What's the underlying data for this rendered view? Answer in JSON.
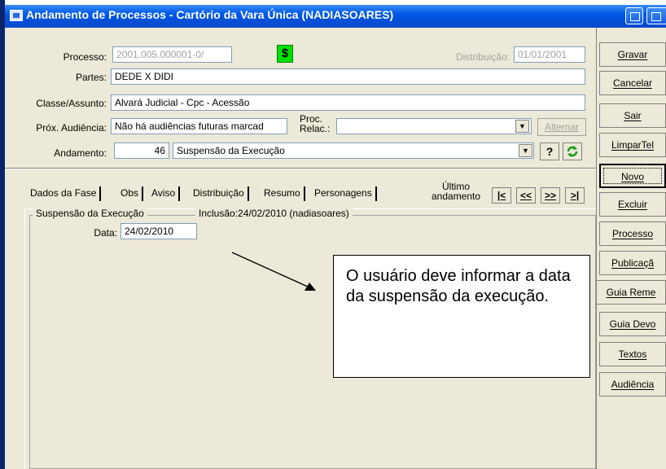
{
  "window": {
    "title": "Andamento de Processos - Cartório da Vara Única (NADIASOARES)"
  },
  "form": {
    "processo_label": "Processo:",
    "processo_value": "2001.005.000001-0/",
    "distribuicao_label": "Distribuição:",
    "distribuicao_value": "01/01/2001",
    "partes_label": "Partes:",
    "partes_value": "DEDE X DIDI",
    "classe_label": "Classe/Assunto:",
    "classe_value": "Alvará Judicial - Cpc - Acessão",
    "prox_aud_label": "Próx. Audiência:",
    "prox_aud_value": "Não há audiências futuras marcad",
    "proc_relac_label_1": "Proc.",
    "proc_relac_label_2": "Relac.:",
    "proc_relac_value": "",
    "alternar_label": "Alternar",
    "andamento_label": "Andamento:",
    "andamento_code": "46",
    "andamento_value": "Suspensão da Execução",
    "help_label": "?"
  },
  "tabs": [
    "Dados da Fase",
    "Obs",
    "Aviso",
    "Distribuição",
    "Resumo",
    "Personagens"
  ],
  "nav": {
    "ultimo_label_1": "Último",
    "ultimo_label_2": "andamento",
    "buttons": [
      "|<",
      "<<",
      ">>",
      ">|"
    ]
  },
  "fase": {
    "group_label": "Suspensão da Execução",
    "inclusao_label": "Inclusão:24/02/2010 (nadiasoares)",
    "data_label": "Data:",
    "data_value": "24/02/2010"
  },
  "side_buttons": [
    "Gravar",
    "Cancelar",
    "Sair",
    "LimparTel",
    "Novo",
    "Excluir",
    "Processo",
    "Publicaçã",
    "Guia Reme",
    "Guia Devo",
    "Textos",
    "Audiência"
  ],
  "callout": {
    "text": "O usuário deve informar a data da suspensão da execução."
  },
  "icons": {
    "dollar": "dollar-icon",
    "refresh": "refresh-icon"
  },
  "colors": {
    "titlebar": "#0058e6",
    "dollar_bg": "#00e000",
    "window_bg": "#ece9d8"
  }
}
